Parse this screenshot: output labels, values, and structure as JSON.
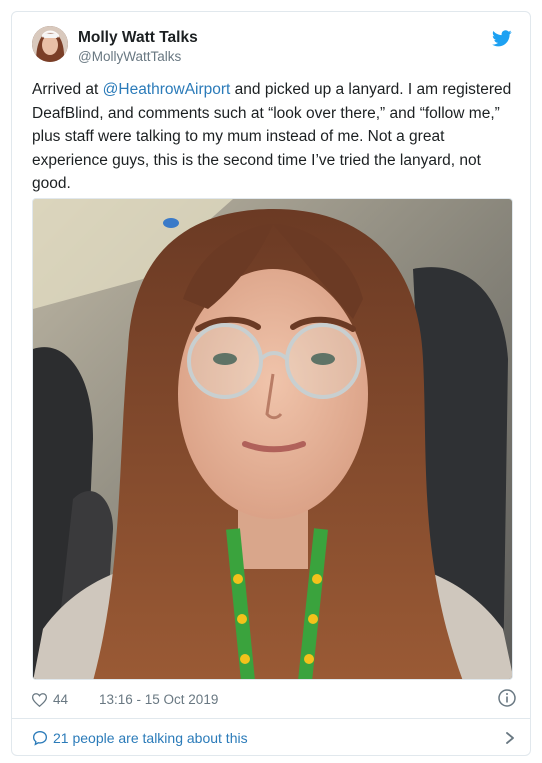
{
  "tweet": {
    "display_name": "Molly Watt Talks",
    "handle": "@MollyWattTalks",
    "text_before": "Arrived at ",
    "mention": "@HeathrowAirport",
    "text_after": " and picked up a lanyard. I am registered DeafBlind, and comments such at “look over there,” and “follow me,” plus staff were talking to my mum instead of me. Not a great experience guys, this is the second time I’ve tried the lanyard, not good.",
    "likes": "44",
    "timestamp": "13:16 - 15 Oct 2019",
    "talking_about": "21 people are talking about this"
  },
  "icons": {
    "brand": "twitter-bird-icon",
    "like": "heart-icon",
    "info": "info-icon",
    "reply": "speech-bubble-icon",
    "more": "chevron-right-icon"
  },
  "colors": {
    "brand_blue": "#1da1f2",
    "link_blue": "#2b7bb9",
    "text": "#1c2022",
    "muted": "#697882",
    "border": "#e1e8ed"
  }
}
